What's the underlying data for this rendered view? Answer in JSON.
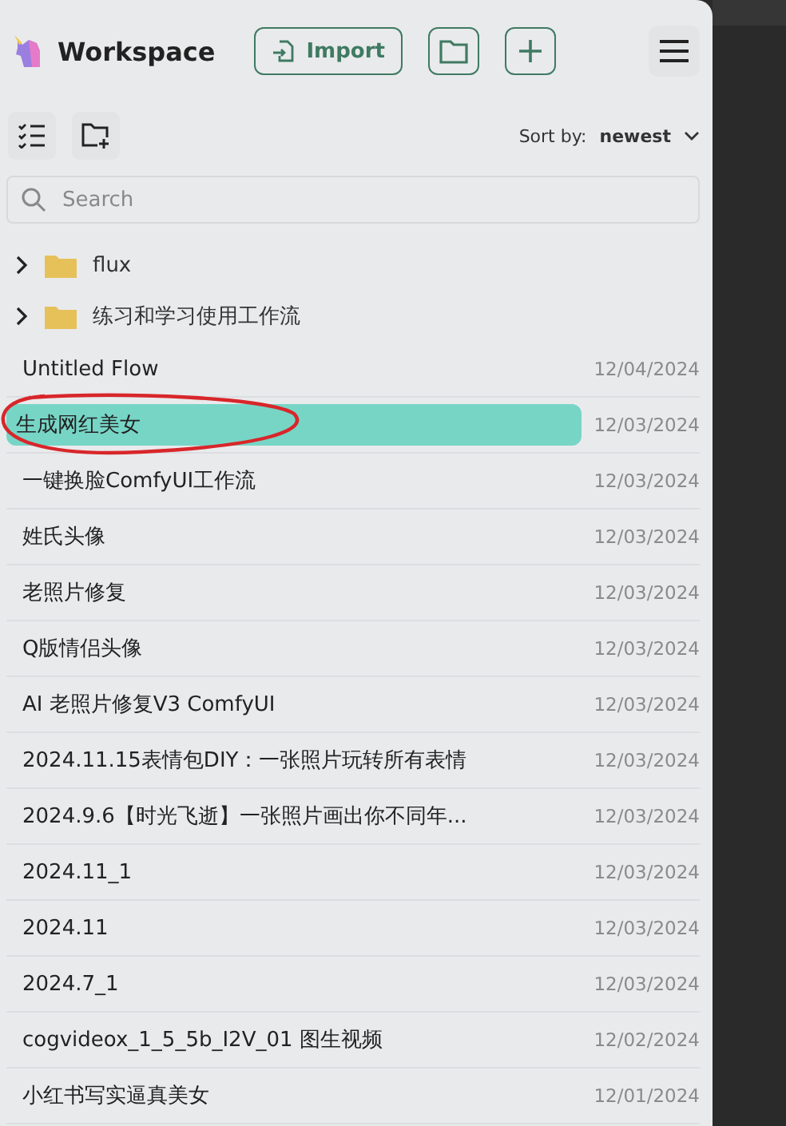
{
  "header": {
    "title": "Workspace",
    "import_label": "Import"
  },
  "toolbar": {
    "sort_label": "Sort by:",
    "sort_value": "newest"
  },
  "search": {
    "placeholder": "Search"
  },
  "folders": [
    {
      "name": "flux",
      "expanded": false
    },
    {
      "name": "练习和学习使用工作流",
      "expanded": false
    }
  ],
  "flows": [
    {
      "name": "Untitled Flow",
      "date": "12/04/2024",
      "selected": false,
      "annotated": false
    },
    {
      "name": "生成网红美女",
      "date": "12/03/2024",
      "selected": true,
      "annotated": true
    },
    {
      "name": "一键换脸ComfyUI工作流",
      "date": "12/03/2024",
      "selected": false,
      "annotated": false
    },
    {
      "name": "姓氏头像",
      "date": "12/03/2024",
      "selected": false,
      "annotated": false
    },
    {
      "name": "老照片修复",
      "date": "12/03/2024",
      "selected": false,
      "annotated": false
    },
    {
      "name": "Q版情侣头像",
      "date": "12/03/2024",
      "selected": false,
      "annotated": false
    },
    {
      "name": "AI 老照片修复V3 ComfyUI",
      "date": "12/03/2024",
      "selected": false,
      "annotated": false
    },
    {
      "name": "2024.11.15表情包DIY：一张照片玩转所有表情",
      "date": "12/03/2024",
      "selected": false,
      "annotated": false
    },
    {
      "name": "2024.9.6【时光飞逝】一张照片画出你不同年...",
      "date": "12/03/2024",
      "selected": false,
      "annotated": false
    },
    {
      "name": "2024.11_1",
      "date": "12/03/2024",
      "selected": false,
      "annotated": false
    },
    {
      "name": "2024.11",
      "date": "12/03/2024",
      "selected": false,
      "annotated": false
    },
    {
      "name": "2024.7_1",
      "date": "12/03/2024",
      "selected": false,
      "annotated": false
    },
    {
      "name": "cogvideox_1_5_5b_I2V_01 图生视频",
      "date": "12/02/2024",
      "selected": false,
      "annotated": false
    },
    {
      "name": "小红书写实逼真美女",
      "date": "12/01/2024",
      "selected": false,
      "annotated": false
    }
  ]
}
